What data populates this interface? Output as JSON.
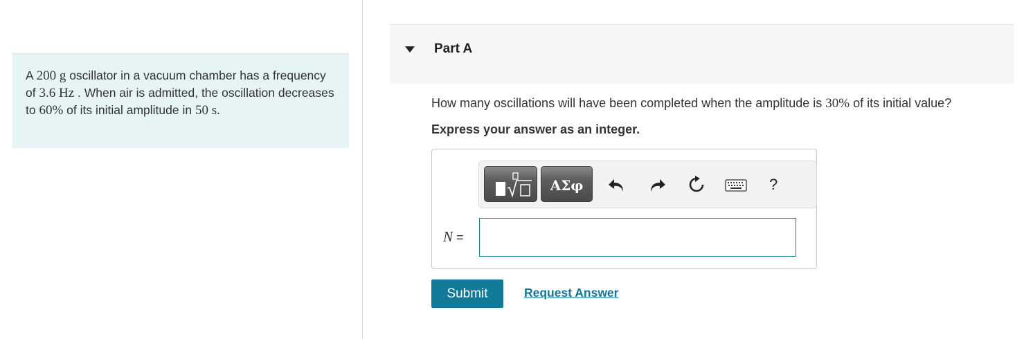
{
  "problem": {
    "t1": "A ",
    "v1": "200",
    "u1": " g",
    "t2": " oscillator in a vacuum chamber has a frequency of ",
    "v2": "3.6",
    "u2": " Hz",
    "t3": " . When air is admitted, the oscillation decreases to ",
    "v3": "60%",
    "t4": " of its initial amplitude in ",
    "v4": "50",
    "u4": " s",
    "t5": "."
  },
  "part": {
    "title": "Part A",
    "icon": "caret-down-icon"
  },
  "question": {
    "t1": "How many oscillations will have been completed when the amplitude is ",
    "v1": "30%",
    "t2": " of its initial value?"
  },
  "instruction": "Express your answer as an integer.",
  "toolbar": {
    "templates_icon": "templates-sqrt-icon",
    "greek_label": "ΑΣφ",
    "undo_icon": "undo-icon",
    "redo_icon": "redo-icon",
    "reset_icon": "reset-icon",
    "keyboard_icon": "keyboard-icon",
    "help_label": "?"
  },
  "answer": {
    "variable": "N",
    "equals": " =",
    "value": ""
  },
  "actions": {
    "submit_label": "Submit",
    "request_label": "Request Answer"
  },
  "colors": {
    "accent": "#117a98",
    "link": "#13769a",
    "problem_bg": "#e7f4f5",
    "input_border": "#1e7f8f"
  }
}
